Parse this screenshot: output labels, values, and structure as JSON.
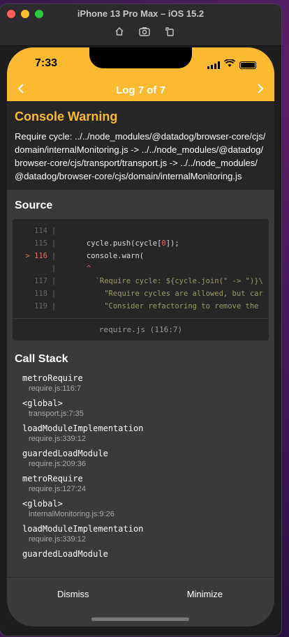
{
  "window": {
    "title": "iPhone 13 Pro Max – iOS 15.2",
    "tools": [
      "home-icon",
      "screenshot-icon",
      "rotate-icon"
    ]
  },
  "status_bar": {
    "time": "7:33"
  },
  "navbar": {
    "title": "Log 7 of 7",
    "prev_icon": "chevron-left-icon",
    "next_icon": "chevron-right-icon"
  },
  "warning": {
    "title": "Console Warning",
    "message": "Require cycle: ../../node_modules/@datadog/browser-core/cjs/domain/internalMonitoring.js -> ../../node_modules/@datadog/browser-core/cjs/transport/transport.js -> ../../node_modules/@datadog/browser-core/cjs/domain/internalMonitoring.js"
  },
  "source": {
    "title": "Source",
    "lines": [
      {
        "gutter": "114",
        "text": "",
        "marker": ""
      },
      {
        "gutter": "115",
        "text_before": "      cycle.push(cycle[",
        "num": "0",
        "text_after": "]);",
        "marker": ""
      },
      {
        "gutter": "116",
        "text": "      console.warn(",
        "marker": ">"
      },
      {
        "gutter": "",
        "text": "      ^",
        "marker": ""
      },
      {
        "gutter": "117",
        "text": "        `Require cycle: ${cycle.join(\" -> \")}\\",
        "marker": ""
      },
      {
        "gutter": "118",
        "text": "          \"Require cycles are allowed, but car",
        "marker": ""
      },
      {
        "gutter": "119",
        "text": "          \"Consider refactoring to remove the",
        "marker": ""
      }
    ],
    "file": "require.js (116:7)"
  },
  "call_stack": {
    "title": "Call Stack",
    "frames": [
      {
        "fn": "metroRequire",
        "loc": "require.js:116:7"
      },
      {
        "fn": "<global>",
        "loc": "transport.js:7:35"
      },
      {
        "fn": "loadModuleImplementation",
        "loc": "require.js:339:12"
      },
      {
        "fn": "guardedLoadModule",
        "loc": "require.js:209:36"
      },
      {
        "fn": "metroRequire",
        "loc": "require.js:127:24"
      },
      {
        "fn": "<global>",
        "loc": "internalMonitoring.js:9:26"
      },
      {
        "fn": "loadModuleImplementation",
        "loc": "require.js:339:12"
      },
      {
        "fn": "guardedLoadModule",
        "loc": ""
      }
    ]
  },
  "bottom_bar": {
    "dismiss": "Dismiss",
    "minimize": "Minimize"
  },
  "colors": {
    "accent": "#fbba32",
    "background": "#3a3a3a"
  }
}
